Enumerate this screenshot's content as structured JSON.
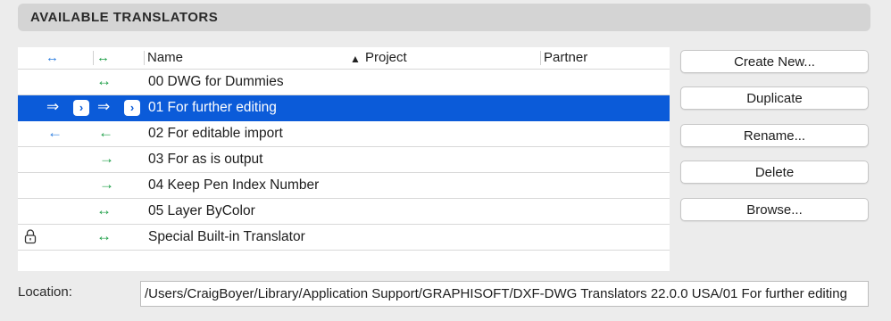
{
  "section": {
    "title": "AVAILABLE TRANSLATORS"
  },
  "table": {
    "columns": {
      "col1_icon": "↔",
      "col2_icon": "↔",
      "name": "Name",
      "sort_indicator": "▲",
      "project": "Project",
      "partner": "Partner"
    },
    "rows": [
      {
        "name": "00 DWG for Dummies",
        "icon1": "",
        "icon2": "↔",
        "icon2_color": "green"
      },
      {
        "name": "01 For further editing",
        "icon1": "⇒",
        "icon2": "⇒",
        "selected": true
      },
      {
        "name": "02 For editable import",
        "icon1": "←",
        "icon2": "←",
        "icon1_color": "blue",
        "icon2_color": "green"
      },
      {
        "name": "03 For as is output",
        "icon1": "",
        "icon2": "→",
        "icon2_color": "green"
      },
      {
        "name": "04 Keep Pen Index Number",
        "icon1": "",
        "icon2": "→",
        "icon2_color": "green"
      },
      {
        "name": "05 Layer ByColor",
        "icon1": "",
        "icon2": "↔",
        "icon2_color": "green"
      },
      {
        "name": "Special Built-in Translator",
        "icon1": "lock-icon",
        "icon2": "↔",
        "icon2_color": "green"
      }
    ]
  },
  "buttons": {
    "create_new": "Create New...",
    "duplicate": "Duplicate",
    "rename": "Rename...",
    "delete": "Delete",
    "browse": "Browse..."
  },
  "location": {
    "label": "Location:",
    "value": "/Users/CraigBoyer/Library/Application Support/GRAPHISOFT/DXF-DWG Translators 22.0.0 USA/01 For further editing"
  },
  "colors": {
    "selection": "#0b5bd9",
    "green_arrow": "#21a04a",
    "blue_arrow": "#2f7fe0"
  }
}
